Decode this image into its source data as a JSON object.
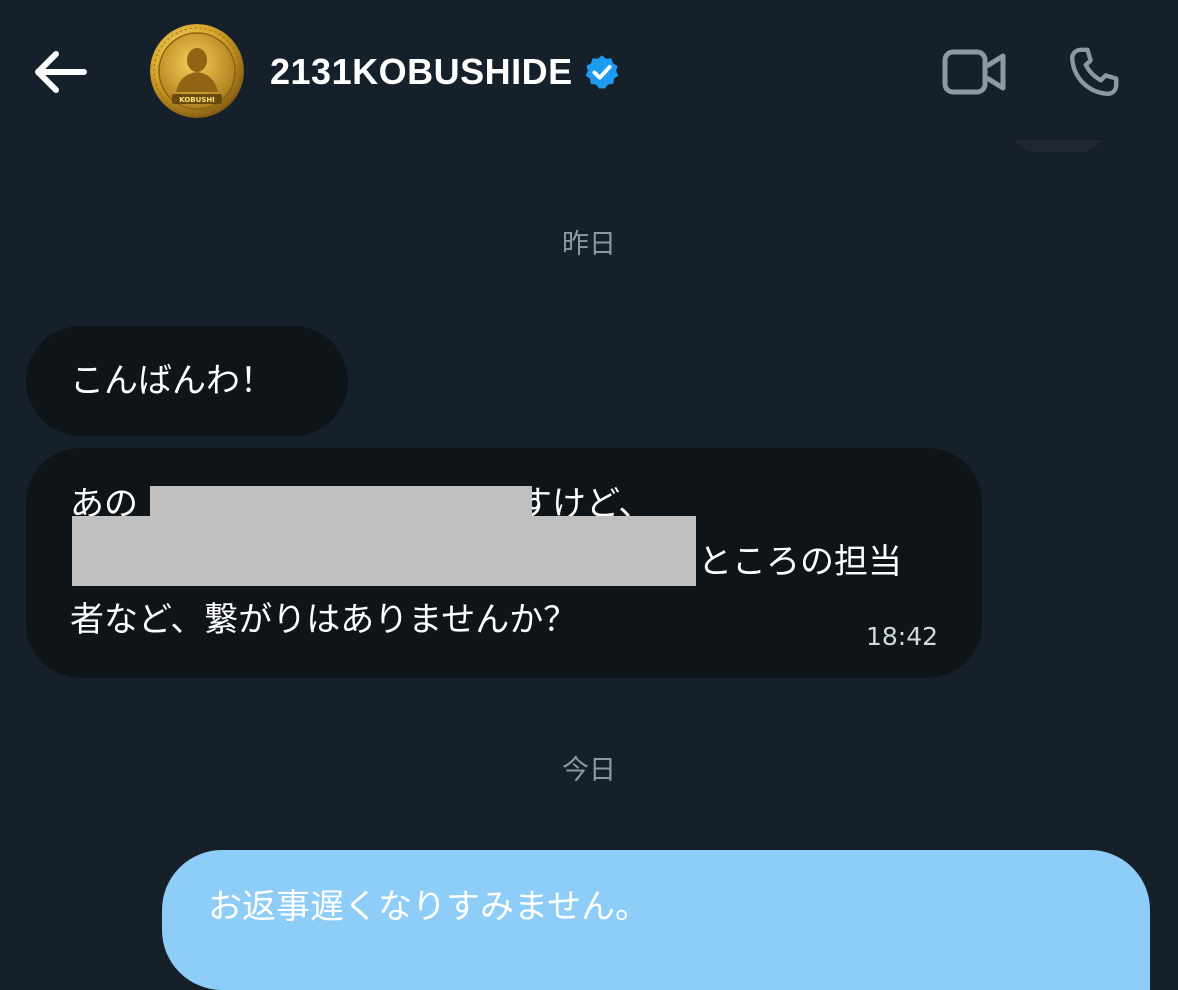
{
  "header": {
    "display_name": "2131KOBUSHIDE",
    "avatar_text": "KOBUSHI",
    "verified": true,
    "accent_color": "#1d9bf0"
  },
  "separators": {
    "yesterday": "昨日",
    "today": "今日"
  },
  "messages": [
    {
      "direction": "received",
      "text": "こんばんわ！"
    },
    {
      "direction": "received",
      "lines": [
        "あの",
        "すけど、",
        "ところの担当",
        "者など、繋がりはありませんか？"
      ],
      "redacted": true,
      "time": "18:42"
    },
    {
      "direction": "sent",
      "text": "お返事遅くなりすみません。"
    }
  ],
  "colors": {
    "background": "#15202b",
    "received_bubble": "#0f1419",
    "sent_bubble": "#8ecdf8",
    "muted_text": "#8b98a5",
    "redaction": "#c0c0c0"
  }
}
